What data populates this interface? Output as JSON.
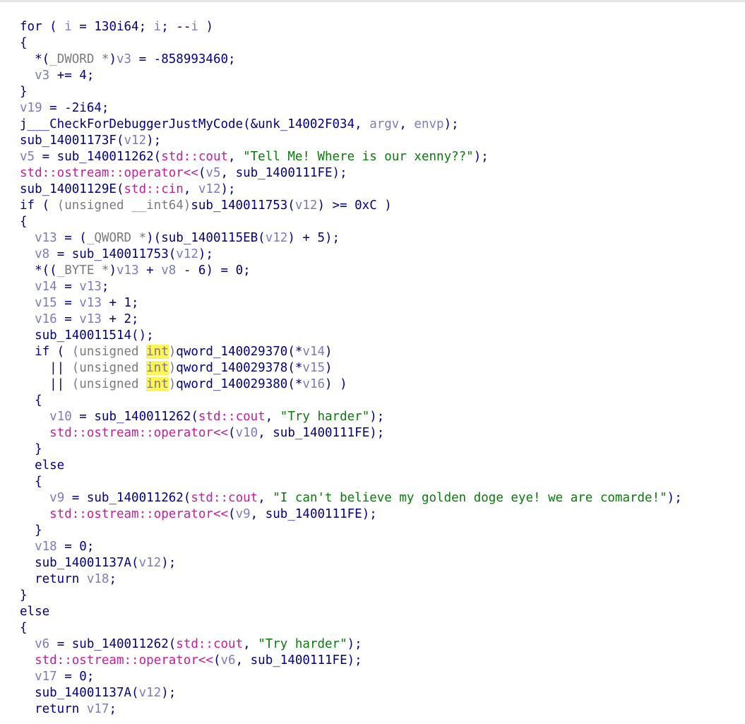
{
  "code_lines": [
    [
      [
        "for ( ",
        "kw"
      ],
      [
        "i",
        "var"
      ],
      [
        " = 130i64; ",
        "kw"
      ],
      [
        "i",
        "var"
      ],
      [
        "; --",
        "kw"
      ],
      [
        "i",
        "var"
      ],
      [
        " )",
        "kw"
      ]
    ],
    [
      [
        "{",
        "kw"
      ]
    ],
    [
      [
        "  *(",
        "kw"
      ],
      [
        "_DWORD *",
        "gray"
      ],
      [
        ")",
        "kw"
      ],
      [
        "v3",
        "var"
      ],
      [
        " = -858993460;",
        "kw"
      ]
    ],
    [
      [
        "  ",
        "kw"
      ],
      [
        "v3",
        "var"
      ],
      [
        " += 4;",
        "kw"
      ]
    ],
    [
      [
        "}",
        "kw"
      ]
    ],
    [
      [
        "v19",
        "var"
      ],
      [
        " = -2i64;",
        "kw"
      ]
    ],
    [
      [
        "j___CheckForDebuggerJustMyCode(&unk_14002F034, ",
        "fn"
      ],
      [
        "argv",
        "var"
      ],
      [
        ", ",
        "kw"
      ],
      [
        "envp",
        "var"
      ],
      [
        ");",
        "kw"
      ]
    ],
    [
      [
        "sub_14001173F(",
        "fn"
      ],
      [
        "v12",
        "var"
      ],
      [
        ");",
        "kw"
      ]
    ],
    [
      [
        "v5",
        "var"
      ],
      [
        " = sub_140011262(",
        "fn"
      ],
      [
        "std::cout",
        "ns"
      ],
      [
        ", ",
        "kw"
      ],
      [
        "\"Tell Me! Where is our xenny??\"",
        "str"
      ],
      [
        ");",
        "kw"
      ]
    ],
    [
      [
        "std::ostream::operator<<",
        "ns"
      ],
      [
        "(",
        "kw"
      ],
      [
        "v5",
        "var"
      ],
      [
        ", sub_1400111FE);",
        "fn"
      ]
    ],
    [
      [
        "sub_14001129E(",
        "fn"
      ],
      [
        "std::cin",
        "ns"
      ],
      [
        ", ",
        "kw"
      ],
      [
        "v12",
        "var"
      ],
      [
        ");",
        "kw"
      ]
    ],
    [
      [
        "if ( ",
        "kw"
      ],
      [
        "(unsigned __int64)",
        "gray"
      ],
      [
        "sub_140011753(",
        "fn"
      ],
      [
        "v12",
        "var"
      ],
      [
        ") >= 0xC )",
        "kw"
      ]
    ],
    [
      [
        "{",
        "kw"
      ]
    ],
    [
      [
        "  ",
        "kw"
      ],
      [
        "v13",
        "var"
      ],
      [
        " = (",
        "kw"
      ],
      [
        "_QWORD *",
        "gray"
      ],
      [
        ")(sub_1400115EB(",
        "fn"
      ],
      [
        "v12",
        "var"
      ],
      [
        ") + 5);",
        "kw"
      ]
    ],
    [
      [
        "  ",
        "kw"
      ],
      [
        "v8",
        "var"
      ],
      [
        " = sub_140011753(",
        "fn"
      ],
      [
        "v12",
        "var"
      ],
      [
        ");",
        "kw"
      ]
    ],
    [
      [
        "  *((",
        "kw"
      ],
      [
        "_BYTE *",
        "gray"
      ],
      [
        ")",
        "kw"
      ],
      [
        "v13",
        "var"
      ],
      [
        " + ",
        "kw"
      ],
      [
        "v8",
        "var"
      ],
      [
        " - 6) = 0;",
        "kw"
      ]
    ],
    [
      [
        "  ",
        "kw"
      ],
      [
        "v14",
        "var"
      ],
      [
        " = ",
        "kw"
      ],
      [
        "v13",
        "var"
      ],
      [
        ";",
        "kw"
      ]
    ],
    [
      [
        "  ",
        "kw"
      ],
      [
        "v15",
        "var"
      ],
      [
        " = ",
        "kw"
      ],
      [
        "v13",
        "var"
      ],
      [
        " + 1;",
        "kw"
      ]
    ],
    [
      [
        "  ",
        "kw"
      ],
      [
        "v16",
        "var"
      ],
      [
        " = ",
        "kw"
      ],
      [
        "v13",
        "var"
      ],
      [
        " + 2;",
        "kw"
      ]
    ],
    [
      [
        "  sub_140011514();",
        "fn"
      ]
    ],
    [
      [
        "  if ( ",
        "kw"
      ],
      [
        "(unsigned ",
        "gray"
      ],
      [
        "int",
        "hl"
      ],
      [
        ")",
        "gray"
      ],
      [
        "qword_140029370(*",
        "fn"
      ],
      [
        "v14",
        "var"
      ],
      [
        ")",
        "kw"
      ]
    ],
    [
      [
        "    || ",
        "kw"
      ],
      [
        "(unsigned ",
        "gray"
      ],
      [
        "int",
        "hl"
      ],
      [
        ")",
        "gray"
      ],
      [
        "qword_140029378(*",
        "fn"
      ],
      [
        "v15",
        "var"
      ],
      [
        ")",
        "kw"
      ]
    ],
    [
      [
        "    || ",
        "kw"
      ],
      [
        "(unsigned ",
        "gray"
      ],
      [
        "int",
        "hl"
      ],
      [
        ")",
        "gray"
      ],
      [
        "qword_140029380(*",
        "fn"
      ],
      [
        "v16",
        "var"
      ],
      [
        ") )",
        "kw"
      ]
    ],
    [
      [
        "  {",
        "kw"
      ]
    ],
    [
      [
        "    ",
        "kw"
      ],
      [
        "v10",
        "var"
      ],
      [
        " = sub_140011262(",
        "fn"
      ],
      [
        "std::cout",
        "ns"
      ],
      [
        ", ",
        "kw"
      ],
      [
        "\"Try harder\"",
        "str"
      ],
      [
        ");",
        "kw"
      ]
    ],
    [
      [
        "    ",
        "kw"
      ],
      [
        "std::ostream::operator<<",
        "ns"
      ],
      [
        "(",
        "kw"
      ],
      [
        "v10",
        "var"
      ],
      [
        ", sub_1400111FE);",
        "fn"
      ]
    ],
    [
      [
        "  }",
        "kw"
      ]
    ],
    [
      [
        "  else",
        "kw"
      ]
    ],
    [
      [
        "  {",
        "kw"
      ]
    ],
    [
      [
        "    ",
        "kw"
      ],
      [
        "v9",
        "var"
      ],
      [
        " = sub_140011262(",
        "fn"
      ],
      [
        "std::cout",
        "ns"
      ],
      [
        ", ",
        "kw"
      ],
      [
        "\"I can't believe my golden doge eye! we are comarde!\"",
        "str"
      ],
      [
        ");",
        "kw"
      ]
    ],
    [
      [
        "    ",
        "kw"
      ],
      [
        "std::ostream::operator<<",
        "ns"
      ],
      [
        "(",
        "kw"
      ],
      [
        "v9",
        "var"
      ],
      [
        ", sub_1400111FE);",
        "fn"
      ]
    ],
    [
      [
        "  }",
        "kw"
      ]
    ],
    [
      [
        "  ",
        "kw"
      ],
      [
        "v18",
        "var"
      ],
      [
        " = 0;",
        "kw"
      ]
    ],
    [
      [
        "  sub_14001137A(",
        "fn"
      ],
      [
        "v12",
        "var"
      ],
      [
        ");",
        "kw"
      ]
    ],
    [
      [
        "  return ",
        "kw"
      ],
      [
        "v18",
        "var"
      ],
      [
        ";",
        "kw"
      ]
    ],
    [
      [
        "}",
        "kw"
      ]
    ],
    [
      [
        "else",
        "kw"
      ]
    ],
    [
      [
        "{",
        "kw"
      ]
    ],
    [
      [
        "  ",
        "kw"
      ],
      [
        "v6",
        "var"
      ],
      [
        " = sub_140011262(",
        "fn"
      ],
      [
        "std::cout",
        "ns"
      ],
      [
        ", ",
        "kw"
      ],
      [
        "\"Try harder\"",
        "str"
      ],
      [
        ");",
        "kw"
      ]
    ],
    [
      [
        "  ",
        "kw"
      ],
      [
        "std::ostream::operator<<",
        "ns"
      ],
      [
        "(",
        "kw"
      ],
      [
        "v6",
        "var"
      ],
      [
        ", sub_1400111FE);",
        "fn"
      ]
    ],
    [
      [
        "  ",
        "kw"
      ],
      [
        "v17",
        "var"
      ],
      [
        " = 0;",
        "kw"
      ]
    ],
    [
      [
        "  sub_14001137A(",
        "fn"
      ],
      [
        "v12",
        "var"
      ],
      [
        ");",
        "kw"
      ]
    ],
    [
      [
        "  return ",
        "kw"
      ],
      [
        "v17",
        "var"
      ],
      [
        ";",
        "kw"
      ]
    ]
  ]
}
